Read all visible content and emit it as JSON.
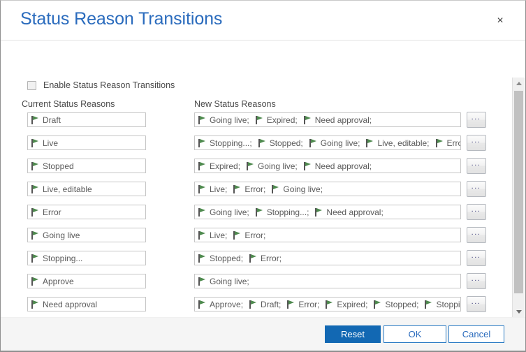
{
  "dialog": {
    "title": "Status Reason Transitions",
    "close_label": "×"
  },
  "options": {
    "enable_label": "Enable Status Reason Transitions",
    "enabled": false
  },
  "columns": {
    "current_header": "Current Status Reasons",
    "new_header": "New Status Reasons"
  },
  "icons": {
    "flag": "flag-icon",
    "ellipsis": "..."
  },
  "rows": [
    {
      "current": "Draft",
      "new": [
        "Going live;",
        "Expired;",
        "Need approval;"
      ],
      "more_label": "..."
    },
    {
      "current": "Live",
      "new": [
        "Stopping...;",
        "Stopped;",
        "Going live;",
        "Live, editable;",
        "Error;"
      ],
      "more_label": "..."
    },
    {
      "current": "Stopped",
      "new": [
        "Expired;",
        "Going live;",
        "Need approval;"
      ],
      "more_label": "..."
    },
    {
      "current": "Live, editable",
      "new": [
        "Live;",
        "Error;",
        "Going live;"
      ],
      "more_label": "..."
    },
    {
      "current": "Error",
      "new": [
        "Going live;",
        "Stopping...;",
        "Need approval;"
      ],
      "more_label": "..."
    },
    {
      "current": "Going live",
      "new": [
        "Live;",
        "Error;"
      ],
      "more_label": "..."
    },
    {
      "current": "Stopping...",
      "new": [
        "Stopped;",
        "Error;"
      ],
      "more_label": "..."
    },
    {
      "current": "Approve",
      "new": [
        "Going live;"
      ],
      "more_label": "..."
    },
    {
      "current": "Need approval",
      "new": [
        "Approve;",
        "Draft;",
        "Error;",
        "Expired;",
        "Stopped;",
        "Stopping...;"
      ],
      "more_label": "..."
    }
  ],
  "footer": {
    "reset_label": "Reset",
    "ok_label": "OK",
    "cancel_label": "Cancel"
  },
  "colors": {
    "accent": "#1268b3",
    "title": "#2a6bbd",
    "flag_green": "#4f8a4f",
    "flag_pole": "#555555",
    "footer_bg": "#f5f5f5"
  }
}
